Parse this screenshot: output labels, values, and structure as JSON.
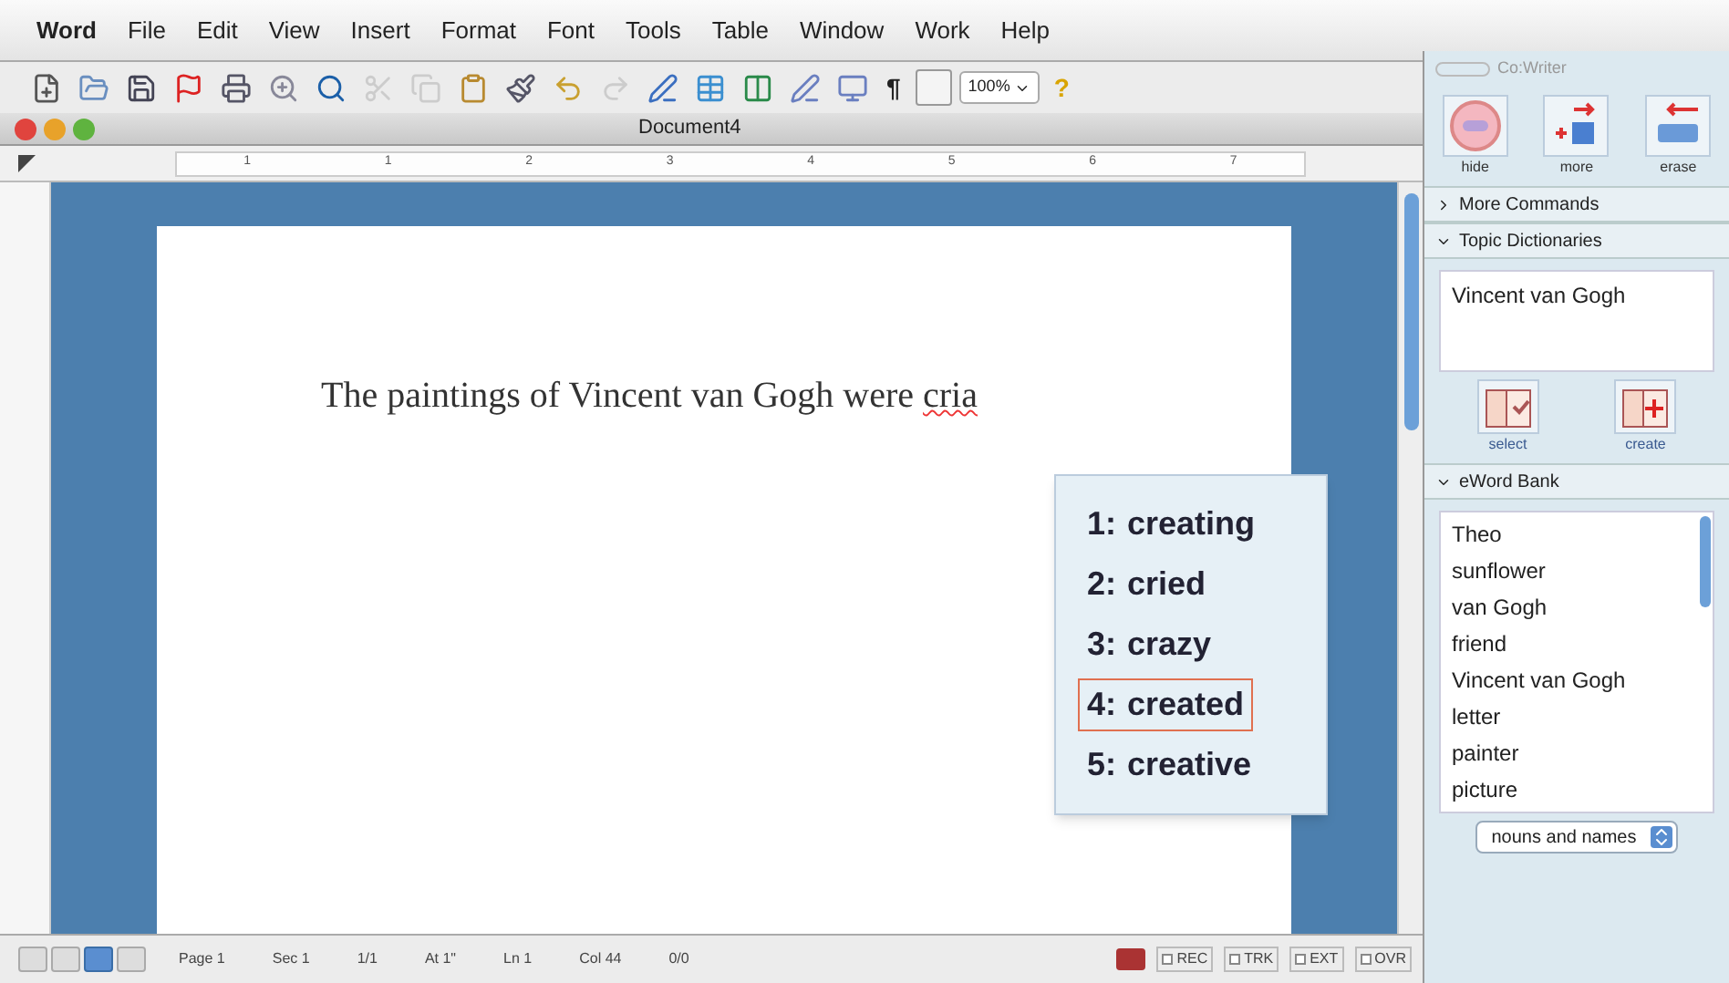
{
  "menu_bar": [
    {
      "label": "Word",
      "bold": true
    },
    {
      "label": "File",
      "bold": false
    },
    {
      "label": "Edit",
      "bold": false
    },
    {
      "label": "View",
      "bold": false
    },
    {
      "label": "Insert",
      "bold": false
    },
    {
      "label": "Format",
      "bold": false
    },
    {
      "label": "Font",
      "bold": false
    },
    {
      "label": "Tools",
      "bold": false
    },
    {
      "label": "Table",
      "bold": false
    },
    {
      "label": "Window",
      "bold": false
    },
    {
      "label": "Work",
      "bold": false
    },
    {
      "label": "Help",
      "bold": false
    }
  ],
  "toolbar": {
    "zoom": "100%",
    "paragraph_mark": "¶",
    "help": "?"
  },
  "window": {
    "title": "Document4"
  },
  "ruler_labels": [
    "1",
    "1",
    "2",
    "3",
    "4",
    "5",
    "6",
    "7"
  ],
  "document": {
    "segments": [
      {
        "kind": "plain",
        "text": "The paintings of Vincent van Gogh were "
      },
      {
        "kind": "misspelled",
        "text": "cria"
      }
    ]
  },
  "suggestions": [
    {
      "number": "1:",
      "word": "creating",
      "selected": false
    },
    {
      "number": "2:",
      "word": "cried",
      "selected": false
    },
    {
      "number": "3:",
      "word": "crazy",
      "selected": false
    },
    {
      "number": "4:",
      "word": "created",
      "selected": true
    },
    {
      "number": "5:",
      "word": "creative",
      "selected": false
    }
  ],
  "status_bar": {
    "fields": [
      "Page 1",
      "Sec 1",
      "1/1",
      "At 1\"",
      "Ln 1",
      "Col 44",
      "0/0"
    ],
    "views": [
      {
        "selected": false
      },
      {
        "selected": false
      },
      {
        "selected": true
      },
      {
        "selected": false
      }
    ],
    "modes": [
      {
        "label": "REC",
        "checked": false
      },
      {
        "label": "TRK",
        "checked": false
      },
      {
        "label": "EXT",
        "checked": false
      },
      {
        "label": "OVR",
        "checked": false
      }
    ]
  },
  "cowriter": {
    "title": "Co:Writer",
    "tools": [
      {
        "kind": "hide",
        "label": "hide"
      },
      {
        "kind": "more",
        "label": "more"
      },
      {
        "kind": "erase",
        "label": "erase"
      }
    ],
    "sections": [
      {
        "title": "More Commands",
        "expanded": false
      },
      {
        "kind": "topics",
        "title": "Topic Dictionaries",
        "expanded": true,
        "items": [
          "Vincent van Gogh"
        ],
        "buttons": [
          {
            "kind": "select",
            "label": "select"
          },
          {
            "kind": "create",
            "label": "create"
          }
        ]
      },
      {
        "kind": "wordbank",
        "title": "eWord Bank",
        "expanded": true,
        "items": [
          "Theo",
          "sunflower",
          "van Gogh",
          "friend",
          "Vincent van Gogh",
          "letter",
          "painter",
          "picture"
        ],
        "dropdown": "nouns and names"
      }
    ]
  }
}
